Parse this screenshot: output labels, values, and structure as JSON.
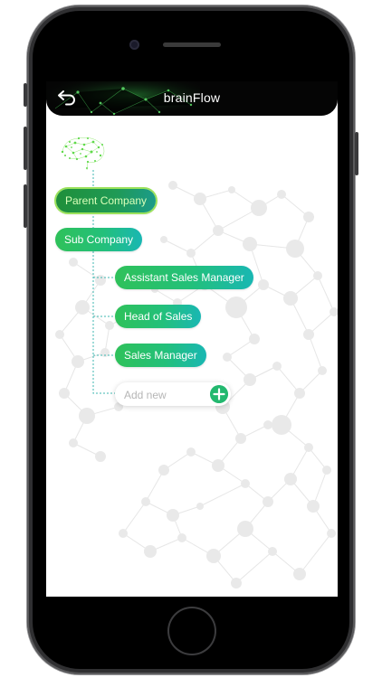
{
  "header": {
    "title": "brainFlow",
    "back_icon": "back-arrow-icon"
  },
  "tree": {
    "root_icon": "brain-network-icon",
    "parent": {
      "label": "Parent Company"
    },
    "child": {
      "label": "Sub Company"
    },
    "items": [
      {
        "label": "Assistant Sales Manager"
      },
      {
        "label": "Head of Sales"
      },
      {
        "label": "Sales Manager"
      }
    ],
    "add": {
      "placeholder": "Add new",
      "icon": "plus-icon"
    }
  },
  "colors": {
    "accent_green": "#2fc15a",
    "accent_teal": "#19b7b3",
    "topbar": "#050505",
    "parent_outline": "#9be25b"
  }
}
